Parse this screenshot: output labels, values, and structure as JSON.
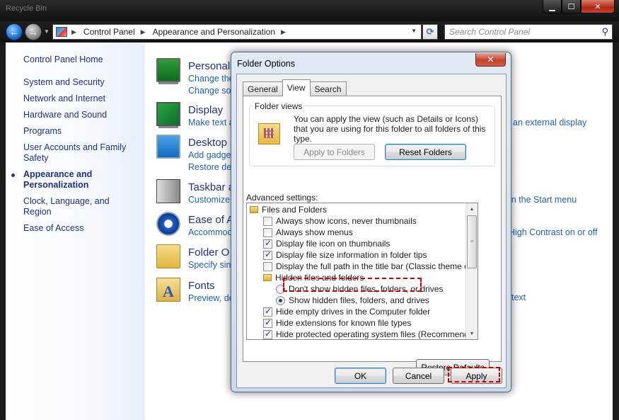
{
  "window": {
    "title": "Recycle Bin",
    "caption": {
      "minimize": "▁",
      "maximize": "☐",
      "close": "✕"
    }
  },
  "address": {
    "crumbs": [
      "Control Panel",
      "Appearance and Personalization"
    ],
    "search_placeholder": "Search Control Panel"
  },
  "nav": {
    "home": "Control Panel Home",
    "items": [
      {
        "label": "System and Security"
      },
      {
        "label": "Network and Internet"
      },
      {
        "label": "Hardware and Sound"
      },
      {
        "label": "Programs"
      },
      {
        "label": "User Accounts and Family Safety"
      },
      {
        "label": "Appearance and Personalization",
        "active": true
      },
      {
        "label": "Clock, Language, and Region"
      },
      {
        "label": "Ease of Access"
      }
    ]
  },
  "content": {
    "categories": [
      {
        "title": "Personal",
        "link1": "Change the",
        "link2": "Change sou",
        "icon": "personalization-icon"
      },
      {
        "title": "Display",
        "link1": "Make text a",
        "link2": "",
        "icon": "display-icon"
      },
      {
        "title": "Desktop",
        "link1": "Add gadget",
        "link2": "Restore des",
        "icon": "desktop-gadgets-icon"
      },
      {
        "title": "Taskbar a",
        "link1": "Customize",
        "link2": "",
        "icon": "taskbar-icon"
      },
      {
        "title": "Ease of A",
        "link1": "Accommod",
        "link2": "",
        "icon": "ease-of-access-icon"
      },
      {
        "title": "Folder O",
        "link1": "Specify sing",
        "link2": "",
        "icon": "folder-options-icon"
      },
      {
        "title": "Fonts",
        "link1": "Preview, de",
        "link2": "",
        "icon": "fonts-icon"
      }
    ],
    "right_fragments": {
      "display": "an external display",
      "taskbar": "in the Start menu",
      "ease": "High Contrast on or off",
      "fonts": "text"
    }
  },
  "dialog": {
    "title": "Folder Options",
    "close": "✕",
    "tabs": [
      "General",
      "View",
      "Search"
    ],
    "selected_tab": "View",
    "folder_views": {
      "label": "Folder views",
      "description": "You can apply the view (such as Details or Icons) that you are using for this folder to all folders of this type.",
      "apply_btn": "Apply to Folders",
      "reset_btn": "Reset Folders"
    },
    "advanced_label": "Advanced settings:",
    "tree": [
      {
        "type": "folder",
        "label": "Files and Folders"
      },
      {
        "type": "checkbox",
        "checked": false,
        "label": "Always show icons, never thumbnails"
      },
      {
        "type": "checkbox",
        "checked": false,
        "label": "Always show menus"
      },
      {
        "type": "checkbox",
        "checked": true,
        "label": "Display file icon on thumbnails"
      },
      {
        "type": "checkbox",
        "checked": true,
        "label": "Display file size information in folder tips"
      },
      {
        "type": "checkbox",
        "checked": false,
        "label": "Display the full path in the title bar (Classic theme only)"
      },
      {
        "type": "folder",
        "label": "Hidden files and folders",
        "indent": 1
      },
      {
        "type": "radio",
        "checked": false,
        "label": "Don't show hidden files, folders, or drives"
      },
      {
        "type": "radio",
        "checked": true,
        "label": "Show hidden files, folders, and drives"
      },
      {
        "type": "checkbox",
        "checked": true,
        "label": "Hide empty drives in the Computer folder"
      },
      {
        "type": "checkbox",
        "checked": true,
        "label": "Hide extensions for known file types"
      },
      {
        "type": "checkbox",
        "checked": true,
        "label": "Hide protected operating system files (Recommended)"
      }
    ],
    "restore_defaults": "Restore Defaults",
    "ok": "OK",
    "cancel": "Cancel",
    "apply": "Apply"
  },
  "colors": {
    "highlight": "#d40000",
    "link": "#1f5fbf",
    "nav_text": "#1e3287"
  }
}
